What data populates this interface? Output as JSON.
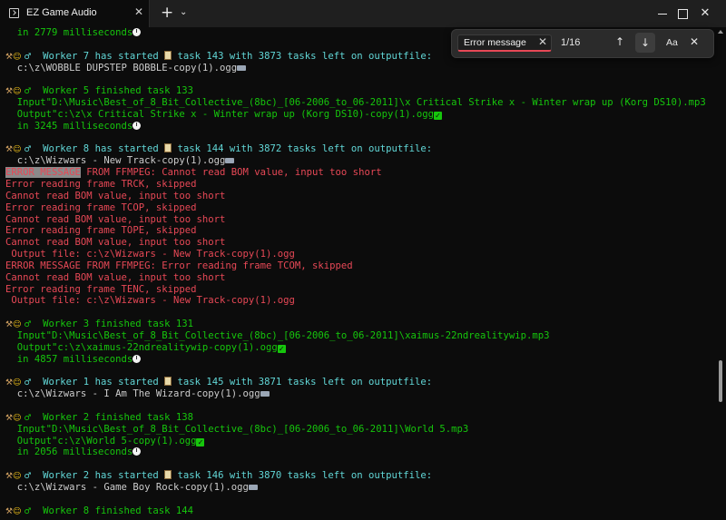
{
  "window": {
    "tab_title": "EZ Game Audio",
    "tab_close": "✕",
    "new_tab": "+",
    "tab_dropdown": "⌄",
    "close_glyph": "✕"
  },
  "find": {
    "query": "Error message",
    "clear_glyph": "✕",
    "count": "1/16",
    "prev_glyph": "↑",
    "next_glyph": "↓",
    "case_label": "Aa",
    "close_glyph": "✕"
  },
  "colors": {
    "green": "#16c60c",
    "cyan": "#61d6d6",
    "red": "#e74856",
    "highlight": "#8a8a8a"
  },
  "icons": [
    "hammer-wrench-icon",
    "worker-icon",
    "male-sign-icon",
    "clipboard-icon",
    "keyboard-icon",
    "check-mark-icon",
    "stopwatch-icon"
  ],
  "terminal": {
    "lines": [
      {
        "color": "green",
        "text": "  in 2779 milliseconds",
        "emoji_after": "clock"
      },
      {
        "color": "white",
        "text": ""
      },
      {
        "color": "cyan",
        "prefix": "worker",
        "text": "  Worker 7 has started ",
        "clip": true,
        "text2": " task 143 with 3873 tasks left on outputfile:"
      },
      {
        "color": "white",
        "text": "  c:\\z\\WOBBLE DUPSTEP BOBBLE-copy(1).ogg",
        "emoji_after": "kbd"
      },
      {
        "color": "white",
        "text": ""
      },
      {
        "color": "green",
        "prefix": "worker",
        "text": "  Worker 5 finished task 133"
      },
      {
        "color": "green",
        "text": "  Input\"D:\\Music\\Best_of_8_Bit_Collective_(8bc)_[06-2006_to_06-2011]\\x Critical Strike x - Winter wrap up (Korg DS10).mp3"
      },
      {
        "color": "green",
        "text": "  Output\"c:\\z\\x Critical Strike x - Winter wrap up (Korg DS10)-copy(1).ogg",
        "emoji_after": "check"
      },
      {
        "color": "green",
        "text": "  in 3245 milliseconds",
        "emoji_after": "clock"
      },
      {
        "color": "white",
        "text": ""
      },
      {
        "color": "cyan",
        "prefix": "worker",
        "text": "  Worker 8 has started ",
        "clip": true,
        "text2": " task 144 with 3872 tasks left on outputfile:"
      },
      {
        "color": "white",
        "text": "  c:\\z\\Wizwars - New Track-copy(1).ogg",
        "emoji_after": "kbd"
      },
      {
        "color": "red",
        "hl": "ERROR MESSAGE",
        "text": " FROM FFMPEG: Cannot read BOM value, input too short"
      },
      {
        "color": "red",
        "text": "Error reading frame TRCK, skipped"
      },
      {
        "color": "red",
        "text": "Cannot read BOM value, input too short"
      },
      {
        "color": "red",
        "text": "Error reading frame TCOP, skipped"
      },
      {
        "color": "red",
        "text": "Cannot read BOM value, input too short"
      },
      {
        "color": "red",
        "text": "Error reading frame TOPE, skipped"
      },
      {
        "color": "red",
        "text": "Cannot read BOM value, input too short"
      },
      {
        "color": "red",
        "text": " Output file: c:\\z\\Wizwars - New Track-copy(1).ogg"
      },
      {
        "color": "red",
        "text": "ERROR MESSAGE FROM FFMPEG: Error reading frame TCOM, skipped"
      },
      {
        "color": "red",
        "text": "Cannot read BOM value, input too short"
      },
      {
        "color": "red",
        "text": "Error reading frame TENC, skipped"
      },
      {
        "color": "red",
        "text": " Output file: c:\\z\\Wizwars - New Track-copy(1).ogg"
      },
      {
        "color": "white",
        "text": ""
      },
      {
        "color": "green",
        "prefix": "worker",
        "text": "  Worker 3 finished task 131"
      },
      {
        "color": "green",
        "text": "  Input\"D:\\Music\\Best_of_8_Bit_Collective_(8bc)_[06-2006_to_06-2011]\\xaimus-22ndrealitywip.mp3"
      },
      {
        "color": "green",
        "text": "  Output\"c:\\z\\xaimus-22ndrealitywip-copy(1).ogg",
        "emoji_after": "check"
      },
      {
        "color": "green",
        "text": "  in 4857 milliseconds",
        "emoji_after": "clock"
      },
      {
        "color": "white",
        "text": ""
      },
      {
        "color": "cyan",
        "prefix": "worker",
        "text": "  Worker 1 has started ",
        "clip": true,
        "text2": " task 145 with 3871 tasks left on outputfile:"
      },
      {
        "color": "white",
        "text": "  c:\\z\\Wizwars - I Am The Wizard-copy(1).ogg",
        "emoji_after": "kbd"
      },
      {
        "color": "white",
        "text": ""
      },
      {
        "color": "green",
        "prefix": "worker",
        "text": "  Worker 2 finished task 138"
      },
      {
        "color": "green",
        "text": "  Input\"D:\\Music\\Best_of_8_Bit_Collective_(8bc)_[06-2006_to_06-2011]\\World 5.mp3"
      },
      {
        "color": "green",
        "text": "  Output\"c:\\z\\World 5-copy(1).ogg",
        "emoji_after": "check"
      },
      {
        "color": "green",
        "text": "  in 2056 milliseconds",
        "emoji_after": "clock"
      },
      {
        "color": "white",
        "text": ""
      },
      {
        "color": "cyan",
        "prefix": "worker",
        "text": "  Worker 2 has started ",
        "clip": true,
        "text2": " task 146 with 3870 tasks left on outputfile:"
      },
      {
        "color": "white",
        "text": "  c:\\z\\Wizwars - Game Boy Rock-copy(1).ogg",
        "emoji_after": "kbd"
      },
      {
        "color": "white",
        "text": ""
      },
      {
        "color": "green",
        "prefix": "worker",
        "text": "  Worker 8 finished task 144"
      }
    ]
  }
}
